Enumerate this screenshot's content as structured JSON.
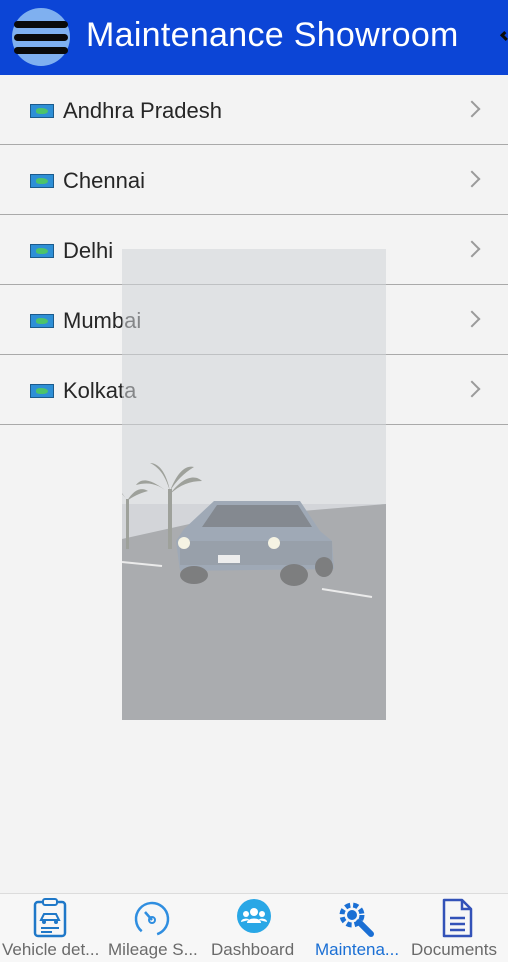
{
  "header": {
    "title": "Maintenance Showroom",
    "background": "#0c45d6",
    "menu_icon": "hamburger-menu-icon"
  },
  "list": {
    "items": [
      {
        "label": "Andhra Pradesh"
      },
      {
        "label": "Chennai"
      },
      {
        "label": "Delhi"
      },
      {
        "label": "Mumbai"
      },
      {
        "label": "Kolkata"
      }
    ]
  },
  "background_image": {
    "subject": "car-photo"
  },
  "bottom_nav": {
    "active_color": "#1a6fd4",
    "items": [
      {
        "label": "Vehicle det...",
        "icon": "vehicle-document-icon"
      },
      {
        "label": "Mileage S...",
        "icon": "speedometer-icon"
      },
      {
        "label": "Dashboard",
        "icon": "group-users-icon"
      },
      {
        "label": "Maintena...",
        "icon": "wrench-gear-icon",
        "active": true
      },
      {
        "label": "Documents",
        "icon": "document-icon"
      }
    ]
  }
}
